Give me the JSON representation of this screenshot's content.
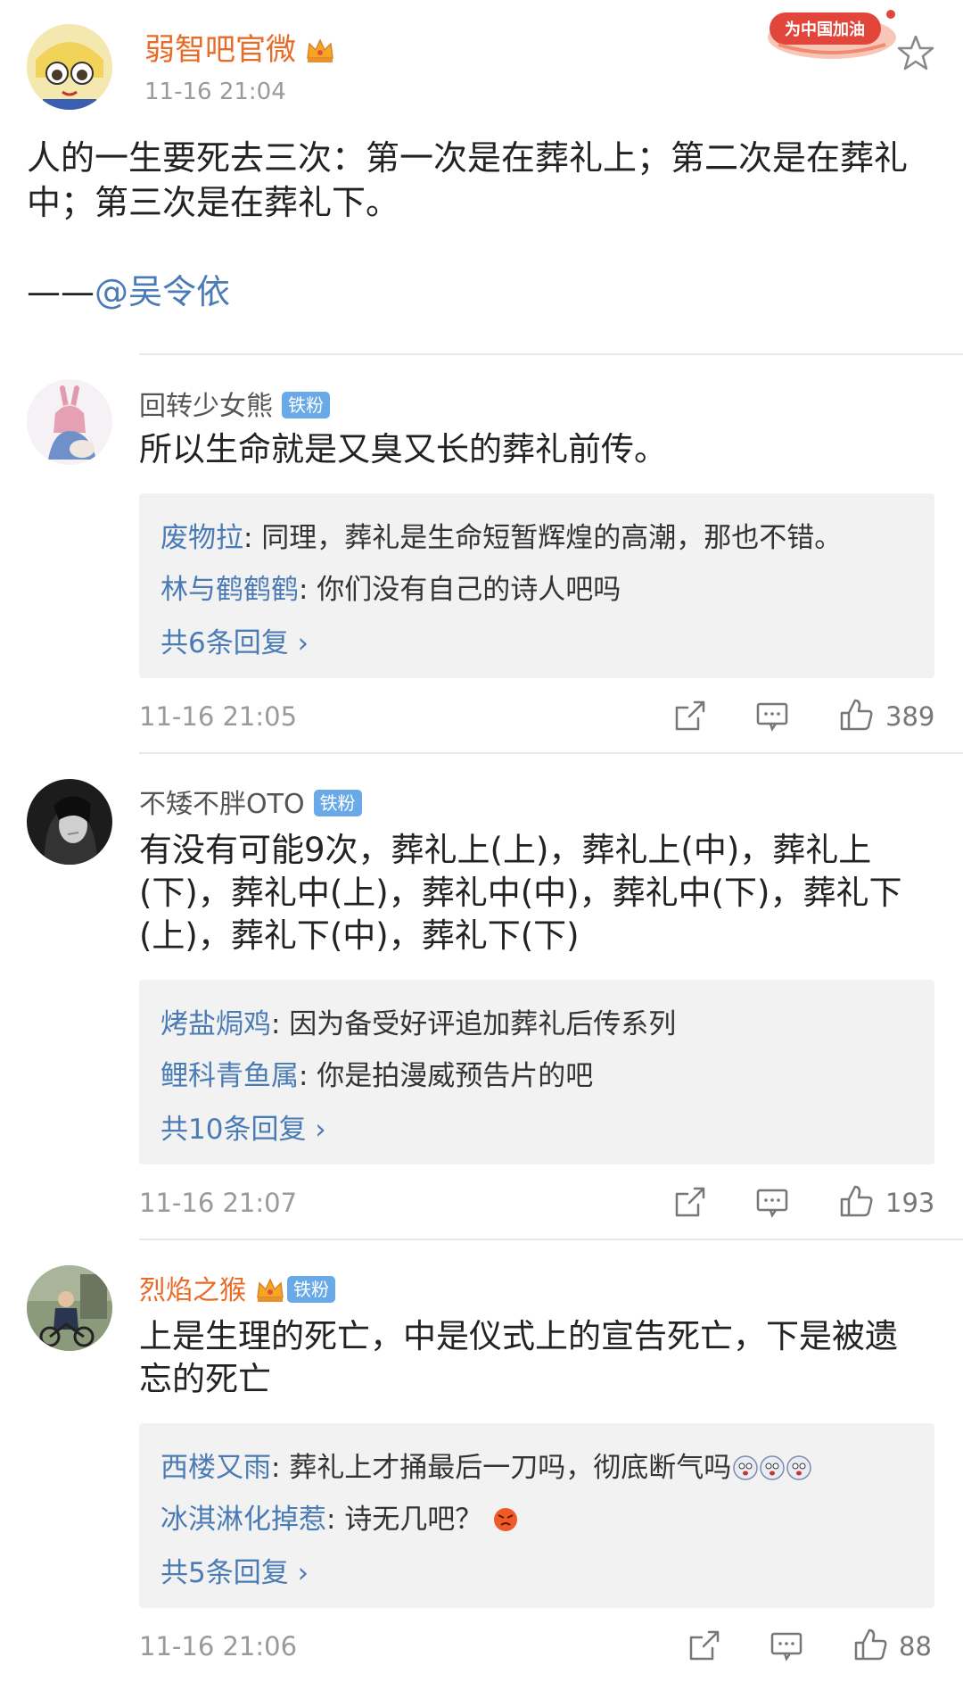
{
  "post": {
    "author": "弱智吧官微",
    "time": "11-16 21:04",
    "banner_text": "为中国加油",
    "text_line1": "人的一生要死去三次：第一次是在葬礼上；第二次是在葬礼",
    "text_line2": "中；第三次是在葬礼下。",
    "attribution_prefix": "——",
    "attribution_mention": "@吴令依"
  },
  "icons": {
    "post_author": "crown-icon",
    "favorite": "star-icon",
    "share": "share-icon",
    "comment": "comment-icon",
    "like": "thumbs-up-icon"
  },
  "colors": {
    "author_name": "#e86b27",
    "link_blue": "#4a7bb5",
    "fan_badge": "#6aa9e8",
    "reply_bg": "#f2f2f2"
  },
  "comments": [
    {
      "name": "回转少女熊",
      "badge": "铁粉",
      "text_lines": [
        "所以生命就是又臭又长的葬礼前传。"
      ],
      "replies": [
        {
          "name": "废物拉",
          "text": ": 同理，葬礼是生命短暂辉煌的高潮，那也不错。"
        },
        {
          "name": "林与鹤鹤鹤",
          "text": ": 你们没有自己的诗人吧吗"
        }
      ],
      "more": "共6条回复 ›",
      "time": "11-16 21:05",
      "likes": "389"
    },
    {
      "name": "不矮不胖OTO",
      "badge": "铁粉",
      "text_lines": [
        "有没有可能9次，葬礼上(上)，葬礼上(中)，葬礼上",
        "(下)，葬礼中(上)，葬礼中(中)，葬礼中(下)，葬礼下",
        "(上)，葬礼下(中)，葬礼下(下)"
      ],
      "replies": [
        {
          "name": "烤盐焗鸡",
          "text": ": 因为备受好评追加葬礼后传系列"
        },
        {
          "name": "鲤科青鱼属",
          "text": ": 你是拍漫威预告片的吧"
        }
      ],
      "more": "共10条回复 ›",
      "time": "11-16 21:07",
      "likes": "193"
    },
    {
      "name": "烈焰之猴",
      "badge": "铁粉",
      "text_lines": [
        "上是生理的死亡，中是仪式上的宣告死亡，下是被遗",
        "忘的死亡"
      ],
      "replies": [
        {
          "name": "西楼又雨",
          "text": ": 葬礼上才捅最后一刀吗，彻底断气吗"
        },
        {
          "name": "冰淇淋化掉惹",
          "text": ": 诗无几吧？"
        }
      ],
      "more": "共5条回复 ›",
      "time": "11-16 21:06",
      "likes": "88"
    }
  ]
}
